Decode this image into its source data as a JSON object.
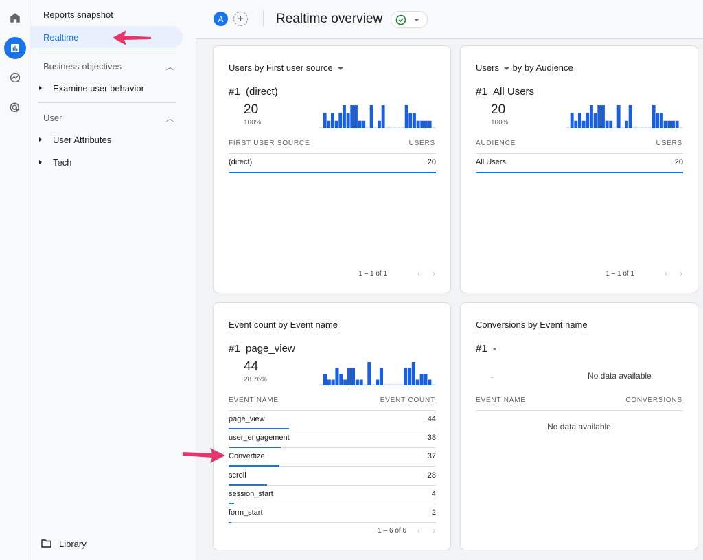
{
  "colors": {
    "accent": "#1a73e8",
    "annotation_arrow": "#e8336b",
    "success": "#188038"
  },
  "rail": {
    "icons": [
      "home-icon",
      "reports-icon",
      "explore-icon",
      "advertising-icon"
    ]
  },
  "nav": {
    "reports_snapshot": "Reports snapshot",
    "realtime": "Realtime",
    "business_objectives": "Business objectives",
    "examine_user_behavior": "Examine user behavior",
    "user": "User",
    "user_attributes": "User Attributes",
    "tech": "Tech",
    "library": "Library"
  },
  "topbar": {
    "avatar_letter": "A",
    "add_label": "+",
    "title": "Realtime overview"
  },
  "cards": {
    "source": {
      "title_metric": "Users",
      "title_rest": " by First user source",
      "rank": "#1",
      "rank_name": "(direct)",
      "value": "20",
      "percent": "100%",
      "col1": "FIRST USER SOURCE",
      "col2": "USERS",
      "rows": [
        {
          "label": "(direct)",
          "value": "20",
          "fraction": 1.0
        }
      ],
      "pager": "1 – 1 of 1",
      "spark": [
        0,
        2,
        1,
        2,
        1,
        2,
        3,
        2,
        3,
        3,
        1,
        1,
        0,
        3,
        0,
        1,
        3,
        0,
        0,
        0,
        0,
        0,
        3,
        2,
        2,
        1,
        1,
        1,
        1,
        0
      ]
    },
    "audience": {
      "title_metric": "Users",
      "title_rest": "by Audience",
      "rank": "#1",
      "rank_name": "All Users",
      "value": "20",
      "percent": "100%",
      "col1": "AUDIENCE",
      "col2": "USERS",
      "rows": [
        {
          "label": "All Users",
          "value": "20",
          "fraction": 1.0
        }
      ],
      "pager": "1 – 1 of 1",
      "spark": [
        0,
        2,
        1,
        2,
        1,
        2,
        3,
        2,
        3,
        3,
        1,
        1,
        0,
        3,
        0,
        1,
        3,
        0,
        0,
        0,
        0,
        0,
        3,
        2,
        2,
        1,
        1,
        1,
        1,
        0
      ]
    },
    "events": {
      "title_metric": "Event count",
      "title_rest": "Event name",
      "title_by": " by ",
      "rank": "#1",
      "rank_name": "page_view",
      "value": "44",
      "percent": "28.76%",
      "col1": "EVENT NAME",
      "col2": "EVENT COUNT",
      "rows": [
        {
          "label": "page_view",
          "value": "44",
          "fraction": 1.0
        },
        {
          "label": "user_engagement",
          "value": "38",
          "fraction": 0.864
        },
        {
          "label": "Convertize",
          "value": "37",
          "fraction": 0.841
        },
        {
          "label": "scroll",
          "value": "28",
          "fraction": 0.636
        },
        {
          "label": "session_start",
          "value": "4",
          "fraction": 0.091
        },
        {
          "label": "form_start",
          "value": "2",
          "fraction": 0.045
        }
      ],
      "pager": "1 – 6 of 6",
      "spark": [
        0,
        2,
        1,
        1,
        3,
        2,
        1,
        3,
        3,
        1,
        1,
        0,
        4,
        0,
        1,
        3,
        0,
        0,
        0,
        0,
        0,
        3,
        3,
        4,
        1,
        2,
        2,
        1,
        0
      ]
    },
    "conversions": {
      "title_metric": "Conversions",
      "title_by": " by ",
      "title_rest": "Event name",
      "rank": "#1",
      "rank_name": "-",
      "value_dash": "-",
      "chart_empty": "No data available",
      "col1": "EVENT NAME",
      "col2": "CONVERSIONS",
      "table_empty": "No data available"
    }
  },
  "pager_prev": "‹",
  "pager_next": "›"
}
